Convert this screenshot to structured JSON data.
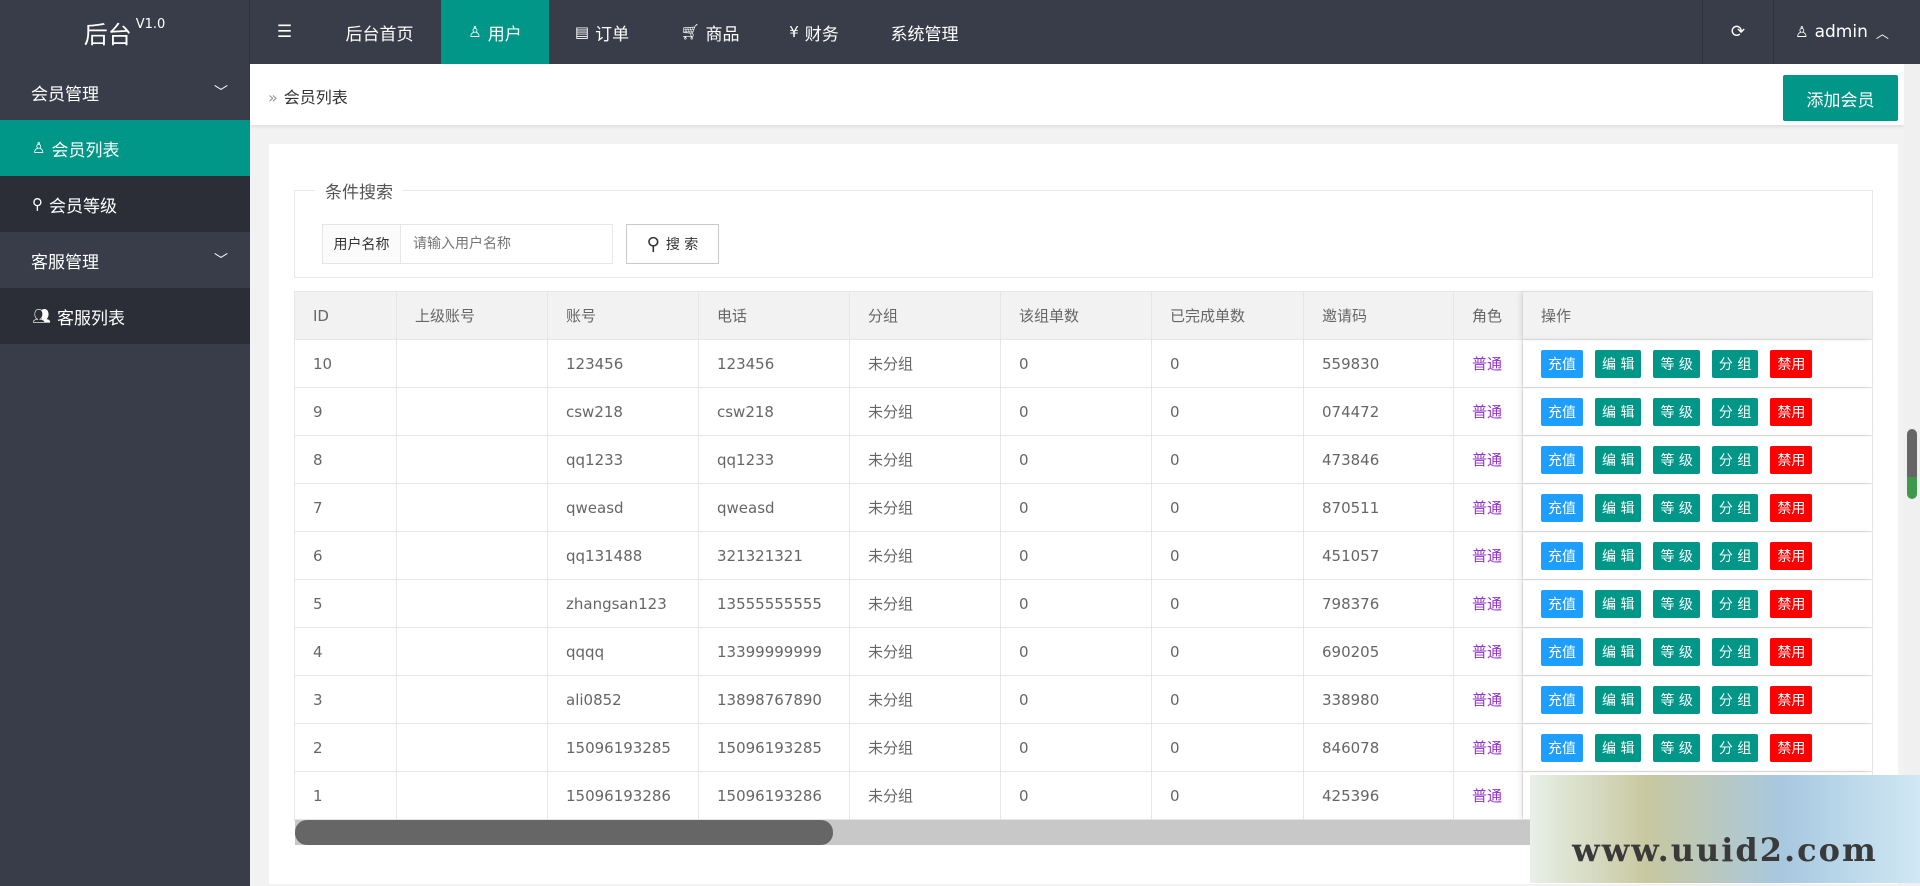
{
  "app": {
    "title": "后台",
    "version": "V1.0"
  },
  "nav": [
    {
      "label": "后台首页",
      "icon": ""
    },
    {
      "label": "用户",
      "icon": "user-icon"
    },
    {
      "label": "订单",
      "icon": "document-icon"
    },
    {
      "label": "商品",
      "icon": "cart-icon"
    },
    {
      "label": "财务",
      "icon": "yen-icon"
    },
    {
      "label": "系统管理",
      "icon": ""
    }
  ],
  "user": {
    "name": "admin"
  },
  "sidebar": {
    "groups": [
      {
        "label": "会员管理",
        "items": [
          "会员列表",
          "会员等级"
        ]
      },
      {
        "label": "客服管理",
        "items": [
          "客服列表"
        ]
      }
    ]
  },
  "breadcrumb": "会员列表",
  "add_button": "添加会员",
  "search": {
    "legend": "条件搜索",
    "label": "用户名称",
    "placeholder": "请输入用户名称",
    "button": "搜 索"
  },
  "table": {
    "headers": [
      "ID",
      "上级账号",
      "账号",
      "电话",
      "分组",
      "该组单数",
      "已完成单数",
      "邀请码",
      "角色",
      "操作"
    ],
    "actions": {
      "recharge": "充值",
      "edit": "编 辑",
      "level": "等 级",
      "group": "分 组",
      "disable": "禁用"
    },
    "rows": [
      [
        "10",
        "",
        "123456",
        "123456",
        "未分组",
        "0",
        "0",
        "559830",
        "普通"
      ],
      [
        "9",
        "",
        "csw218",
        "csw218",
        "未分组",
        "0",
        "0",
        "074472",
        "普通"
      ],
      [
        "8",
        "",
        "qq1233",
        "qq1233",
        "未分组",
        "0",
        "0",
        "473846",
        "普通"
      ],
      [
        "7",
        "",
        "qweasd",
        "qweasd",
        "未分组",
        "0",
        "0",
        "870511",
        "普通"
      ],
      [
        "6",
        "",
        "qq131488",
        "321321321",
        "未分组",
        "0",
        "0",
        "451057",
        "普通"
      ],
      [
        "5",
        "",
        "zhangsan123",
        "13555555555",
        "未分组",
        "0",
        "0",
        "798376",
        "普通"
      ],
      [
        "4",
        "",
        "qqqq",
        "13399999999",
        "未分组",
        "0",
        "0",
        "690205",
        "普通"
      ],
      [
        "3",
        "",
        "ali0852",
        "13898767890",
        "未分组",
        "0",
        "0",
        "338980",
        "普通"
      ],
      [
        "2",
        "",
        "15096193285",
        "15096193285",
        "未分组",
        "0",
        "0",
        "846078",
        "普通"
      ],
      [
        "1",
        "",
        "15096193286",
        "15096193286",
        "未分组",
        "0",
        "0",
        "425396",
        "普通"
      ]
    ]
  },
  "colors": {
    "accent": "#009688",
    "header": "#393d49",
    "recharge": "#1e9fff",
    "disable": "#ff0000",
    "role": "#9933cc"
  },
  "watermark": "www.uuid2.com"
}
